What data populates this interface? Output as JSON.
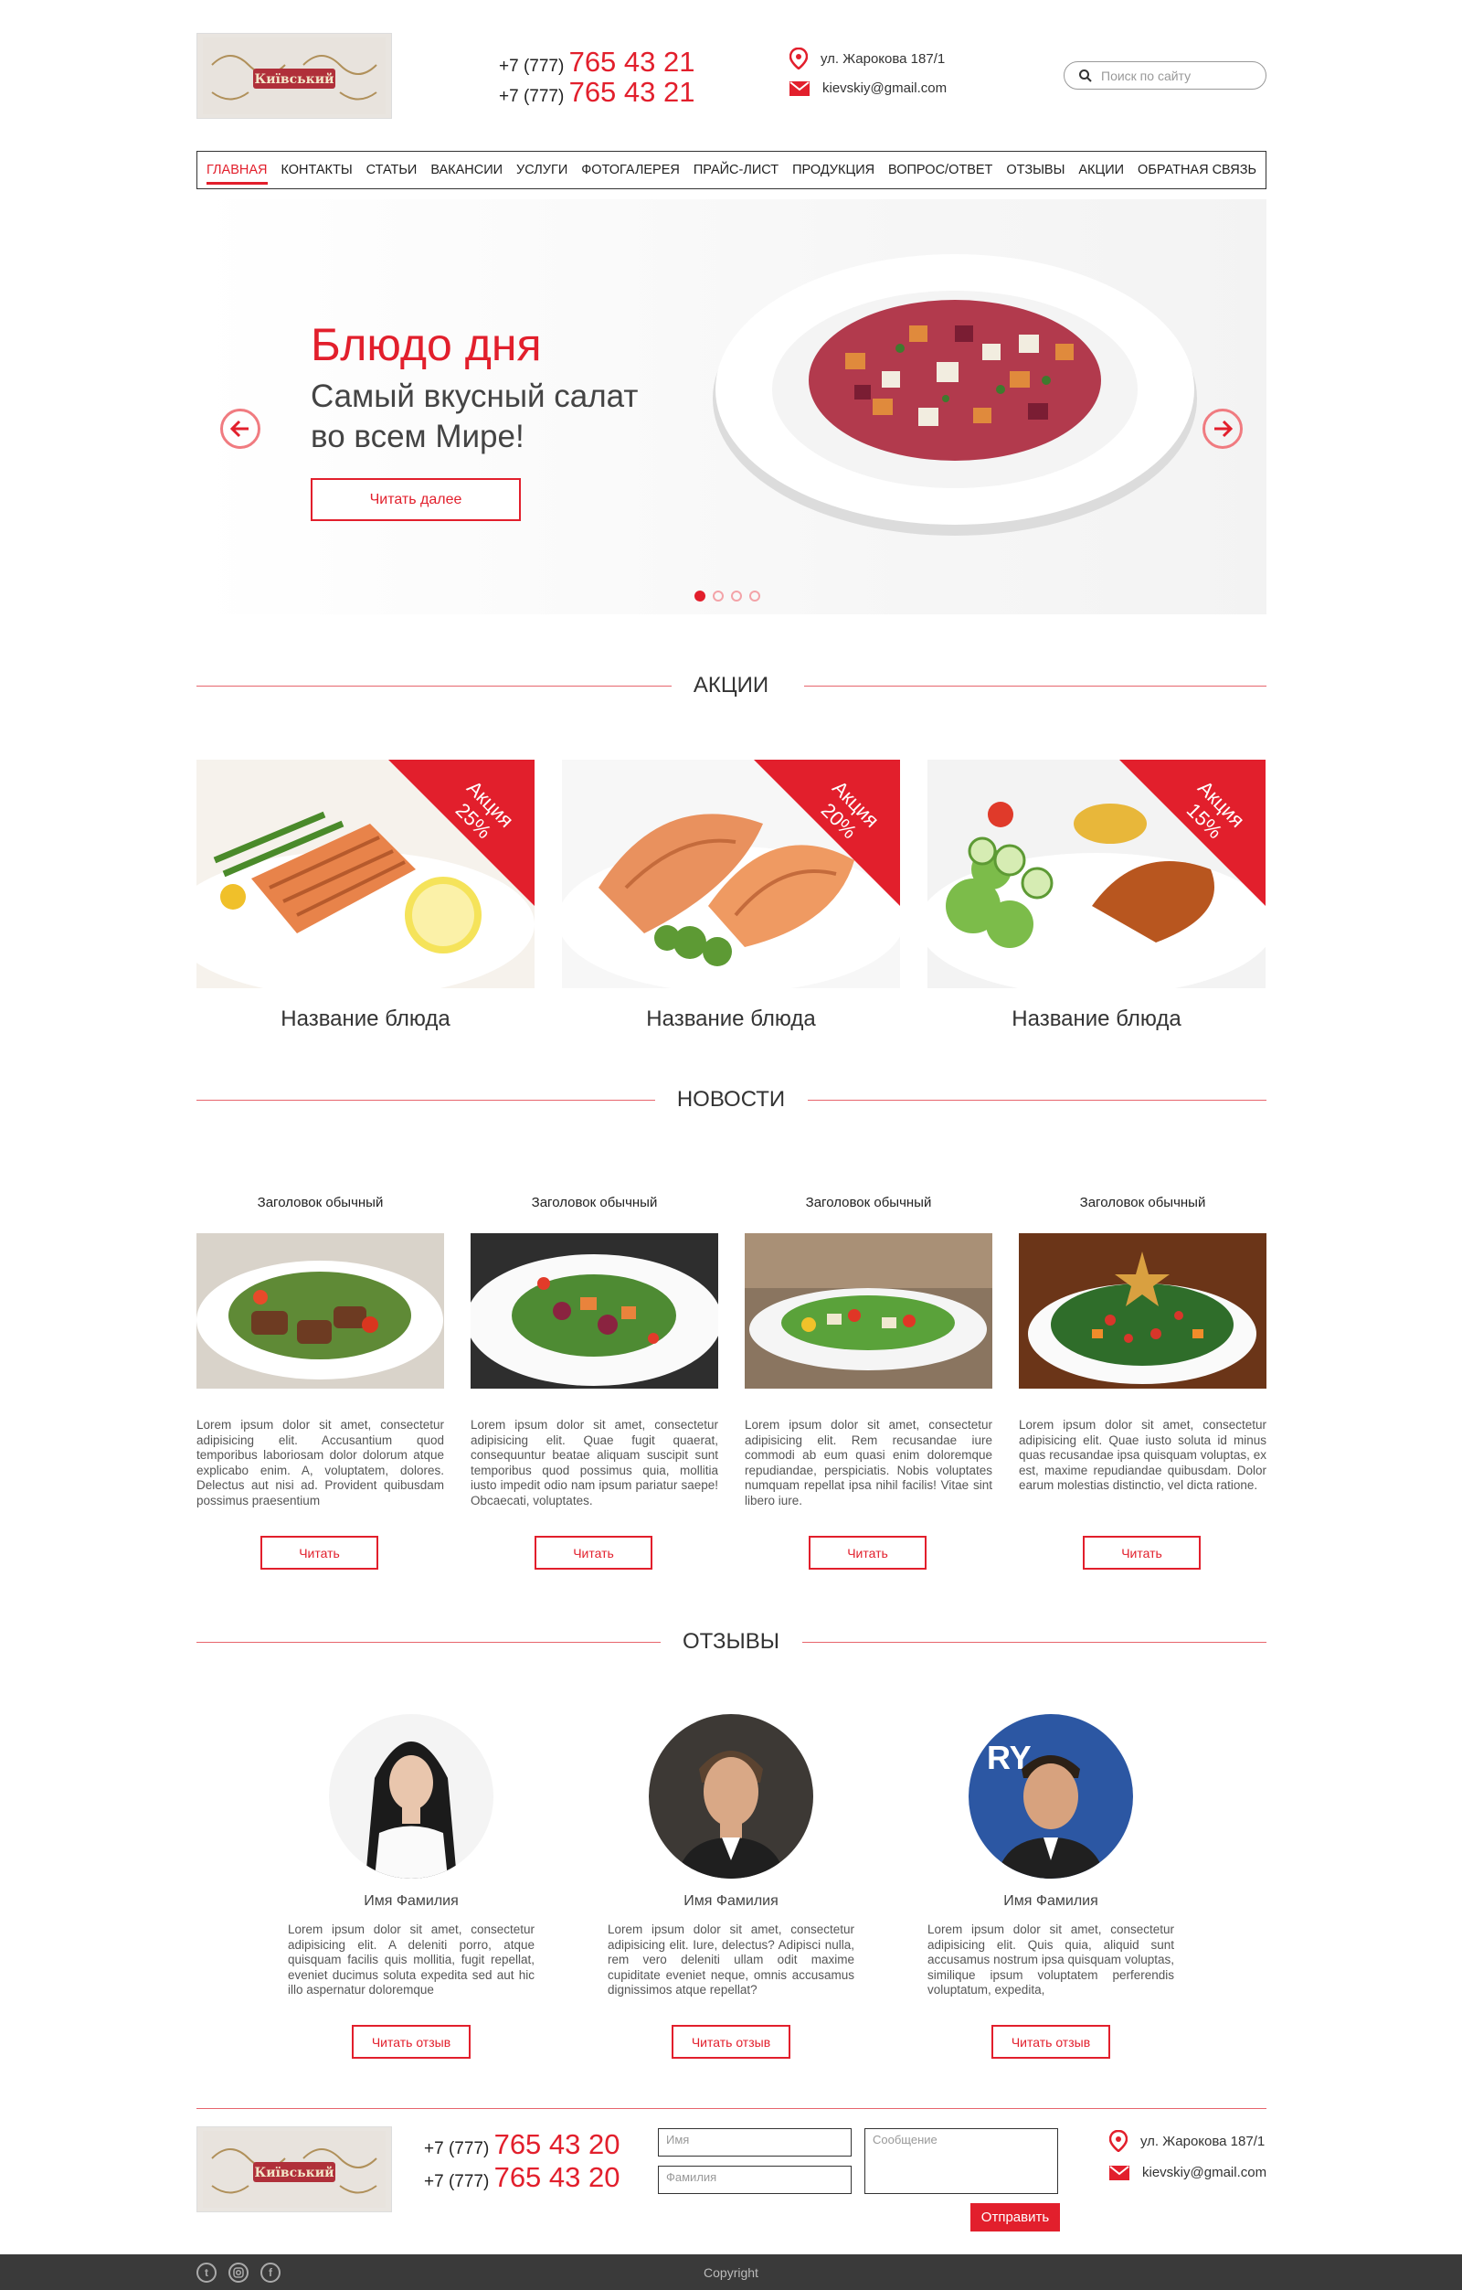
{
  "header": {
    "logo_alt": "Київський",
    "phones": [
      {
        "prefix": "+7 (777)",
        "number": "765 43 21"
      },
      {
        "prefix": "+7 (777)",
        "number": "765 43 21"
      }
    ],
    "address": "ул. Жарокова 187/1",
    "email": "kievskiy@gmail.com",
    "search_placeholder": "Поиск по сайту"
  },
  "nav": [
    "Главная",
    "Контакты",
    "Статьи",
    "Вакансии",
    "Услуги",
    "Фотогалерея",
    "Прайс-лист",
    "Продукция",
    "Вопрос/ответ",
    "Отзывы",
    "Акции",
    "Обратная связь"
  ],
  "hero": {
    "title": "Блюдо дня",
    "subtitle": "Самый вкусный салат во всем Мире!",
    "button": "Читать далее",
    "slides": 4,
    "active_slide": 1
  },
  "promos": {
    "title": "Акции",
    "items": [
      {
        "badge": "Акция",
        "discount": "25%",
        "name": "Название блюда"
      },
      {
        "badge": "Акция",
        "discount": "20%",
        "name": "Название блюда"
      },
      {
        "badge": "Акция",
        "discount": "15%",
        "name": "Название блюда"
      }
    ]
  },
  "news": {
    "title": "Новости",
    "button": "Читать",
    "items": [
      {
        "heading": "Заголовок обычный",
        "text": "Lorem ipsum dolor sit amet, consectetur adipisicing elit. Accusantium quod temporibus laboriosam dolor dolorum atque explicabo enim. A, voluptatem, dolores. Delectus aut nisi ad. Provident quibusdam possimus praesentium"
      },
      {
        "heading": "Заголовок обычный",
        "text": "Lorem ipsum dolor sit amet, consectetur adipisicing elit. Quae fugit quaerat, consequuntur beatae aliquam suscipit sunt temporibus quod possimus quia, mollitia iusto impedit odio nam ipsum pariatur saepe! Obcaecati, voluptates."
      },
      {
        "heading": "Заголовок обычный",
        "text": "Lorem ipsum dolor sit amet, consectetur adipisicing elit. Rem recusandae iure commodi ab eum quasi enim doloremque repudiandae, perspiciatis. Nobis voluptates numquam repellat ipsa nihil facilis! Vitae sint libero iure."
      },
      {
        "heading": "Заголовок обычный",
        "text": "Lorem ipsum dolor sit amet, consectetur adipisicing elit. Quae iusto soluta id minus quas recusandae ipsa quisquam voluptas, ex est, maxime repudiandae quibusdam. Dolor earum molestias distinctio, vel dicta ratione."
      }
    ]
  },
  "reviews": {
    "title": "Отзывы",
    "button": "Читать отзыв",
    "items": [
      {
        "name": "Имя Фамилия",
        "text": "Lorem ipsum dolor sit amet, consectetur adipisicing elit. A deleniti porro, atque quisquam facilis quis mollitia, fugit repellat, eveniet ducimus soluta expedita sed aut hic illo aspernatur doloremque"
      },
      {
        "name": "Имя Фамилия",
        "text": "Lorem ipsum dolor sit amet, consectetur adipisicing elit. Iure, delectus? Adipisci nulla, rem vero deleniti ullam odit maxime cupiditate eveniet neque, omnis accusamus dignissimos atque repellat?"
      },
      {
        "name": "Имя Фамилия",
        "text": "Lorem ipsum dolor sit amet, consectetur adipisicing elit. Quis quia, aliquid sunt accusamus nostrum ipsa quisquam voluptas, similique ipsum voluptatem perferendis voluptatum, expedita,"
      }
    ]
  },
  "footer": {
    "phones": [
      {
        "prefix": "+7 (777)",
        "number": "765 43 20"
      },
      {
        "prefix": "+7 (777)",
        "number": "765 43 20"
      }
    ],
    "name_placeholder": "Имя",
    "surname_placeholder": "Фамилия",
    "message_placeholder": "Сообщение",
    "send": "Отправить",
    "address": "ул. Жарокова 187/1",
    "email": "kievskiy@gmail.com",
    "copyright": "Copyright",
    "social_icons": [
      "twitter-icon",
      "instagram-icon",
      "facebook-icon"
    ]
  },
  "colors": {
    "accent": "#e21f2c",
    "bottom_bar": "#3a3a3a"
  }
}
